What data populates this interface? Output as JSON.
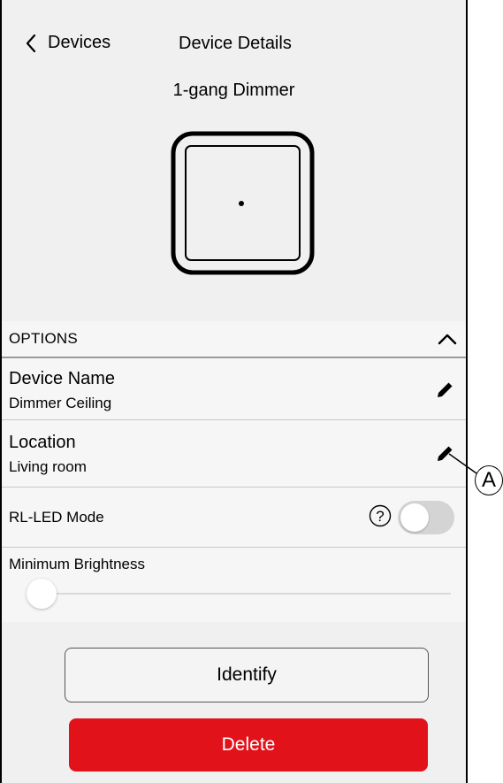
{
  "header": {
    "back_label": "Devices",
    "title": "Device Details",
    "device_type": "1-gang Dimmer"
  },
  "options": {
    "section_label": "OPTIONS",
    "device_name": {
      "label": "Device Name",
      "value": "Dimmer Ceiling"
    },
    "location": {
      "label": "Location",
      "value": "Living room"
    },
    "rl_led_mode": {
      "label": "RL-LED Mode",
      "enabled": false,
      "help": "?"
    },
    "minimum_brightness": {
      "label": "Minimum Brightness",
      "level": 0
    }
  },
  "buttons": {
    "identify": "Identify",
    "delete": "Delete"
  },
  "callout": {
    "label": "A"
  },
  "colors": {
    "background": "#f0f0f0",
    "delete": "#e2121b",
    "toggle_off": "#d4d4d4"
  },
  "icons": [
    "chevron-left-icon",
    "chevron-up-icon",
    "pencil-icon",
    "help-icon"
  ]
}
